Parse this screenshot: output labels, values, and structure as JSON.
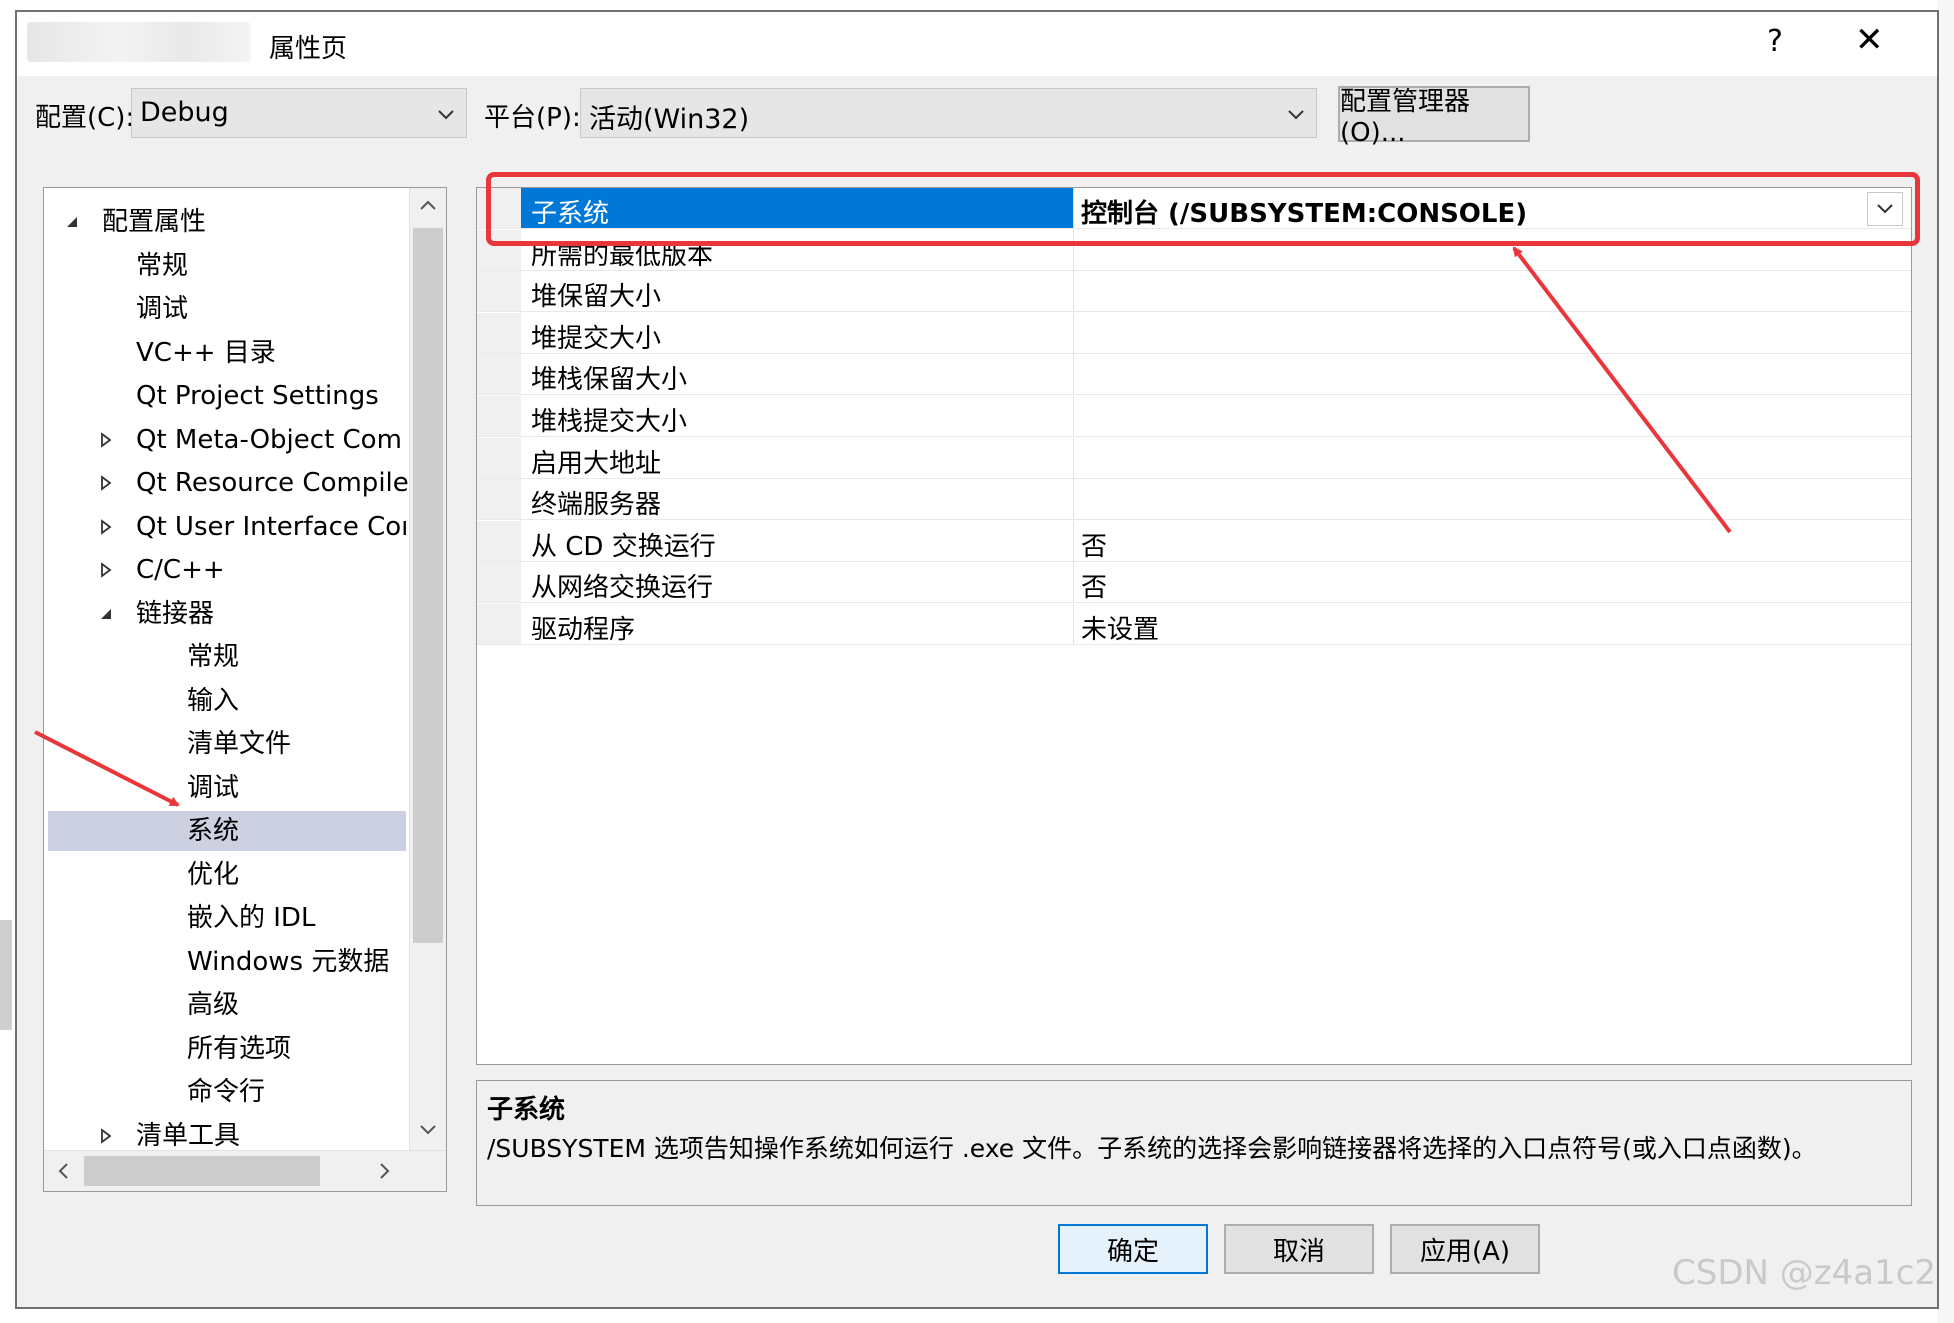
{
  "title": "属性页",
  "titlebar": {
    "help": "?",
    "close": "✕"
  },
  "toolbar": {
    "config_label": "配置(C):",
    "config_value": "Debug",
    "platform_label": "平台(P):",
    "platform_value": "活动(Win32)",
    "config_manager_label": "配置管理器(O)..."
  },
  "tree": {
    "items": [
      {
        "label": "配置属性",
        "expander": "expanded"
      },
      {
        "label": "常规"
      },
      {
        "label": "调试"
      },
      {
        "label": "VC++ 目录"
      },
      {
        "label": "Qt Project Settings"
      },
      {
        "label": "Qt Meta-Object Com",
        "expander": "collapsed"
      },
      {
        "label": "Qt Resource Compile",
        "expander": "collapsed"
      },
      {
        "label": "Qt User Interface Coı",
        "expander": "collapsed"
      },
      {
        "label": "C/C++",
        "expander": "collapsed"
      },
      {
        "label": "链接器",
        "expander": "expanded"
      },
      {
        "label": "常规"
      },
      {
        "label": "输入"
      },
      {
        "label": "清单文件"
      },
      {
        "label": "调试"
      },
      {
        "label": "系统",
        "selected": true
      },
      {
        "label": "优化"
      },
      {
        "label": "嵌入的 IDL"
      },
      {
        "label": "Windows 元数据"
      },
      {
        "label": "高级"
      },
      {
        "label": "所有选项"
      },
      {
        "label": "命令行"
      },
      {
        "label": "清单工具",
        "expander": "collapsed"
      }
    ]
  },
  "grid": {
    "rows": [
      {
        "name": "子系统",
        "value": "控制台 (/SUBSYSTEM:CONSOLE)",
        "selected": true
      },
      {
        "name": "所需的最低版本",
        "value": ""
      },
      {
        "name": "堆保留大小",
        "value": ""
      },
      {
        "name": "堆提交大小",
        "value": ""
      },
      {
        "name": "堆栈保留大小",
        "value": ""
      },
      {
        "name": "堆栈提交大小",
        "value": ""
      },
      {
        "name": "启用大地址",
        "value": ""
      },
      {
        "name": "终端服务器",
        "value": ""
      },
      {
        "name": "从 CD 交换运行",
        "value": "否"
      },
      {
        "name": "从网络交换运行",
        "value": "否"
      },
      {
        "name": "驱动程序",
        "value": "未设置"
      }
    ]
  },
  "description": {
    "title": "子系统",
    "text": "/SUBSYSTEM 选项告知操作系统如何运行 .exe 文件。子系统的选择会影响链接器将选择的入口点符号(或入口点函数)。"
  },
  "buttons": {
    "ok": "确定",
    "cancel": "取消",
    "apply": "应用(A)"
  },
  "watermark": "CSDN @z4a1c2",
  "colors": {
    "selection": "#0078d7",
    "annotation": "#e8363a",
    "tree_selection": "#cdd0e0"
  }
}
